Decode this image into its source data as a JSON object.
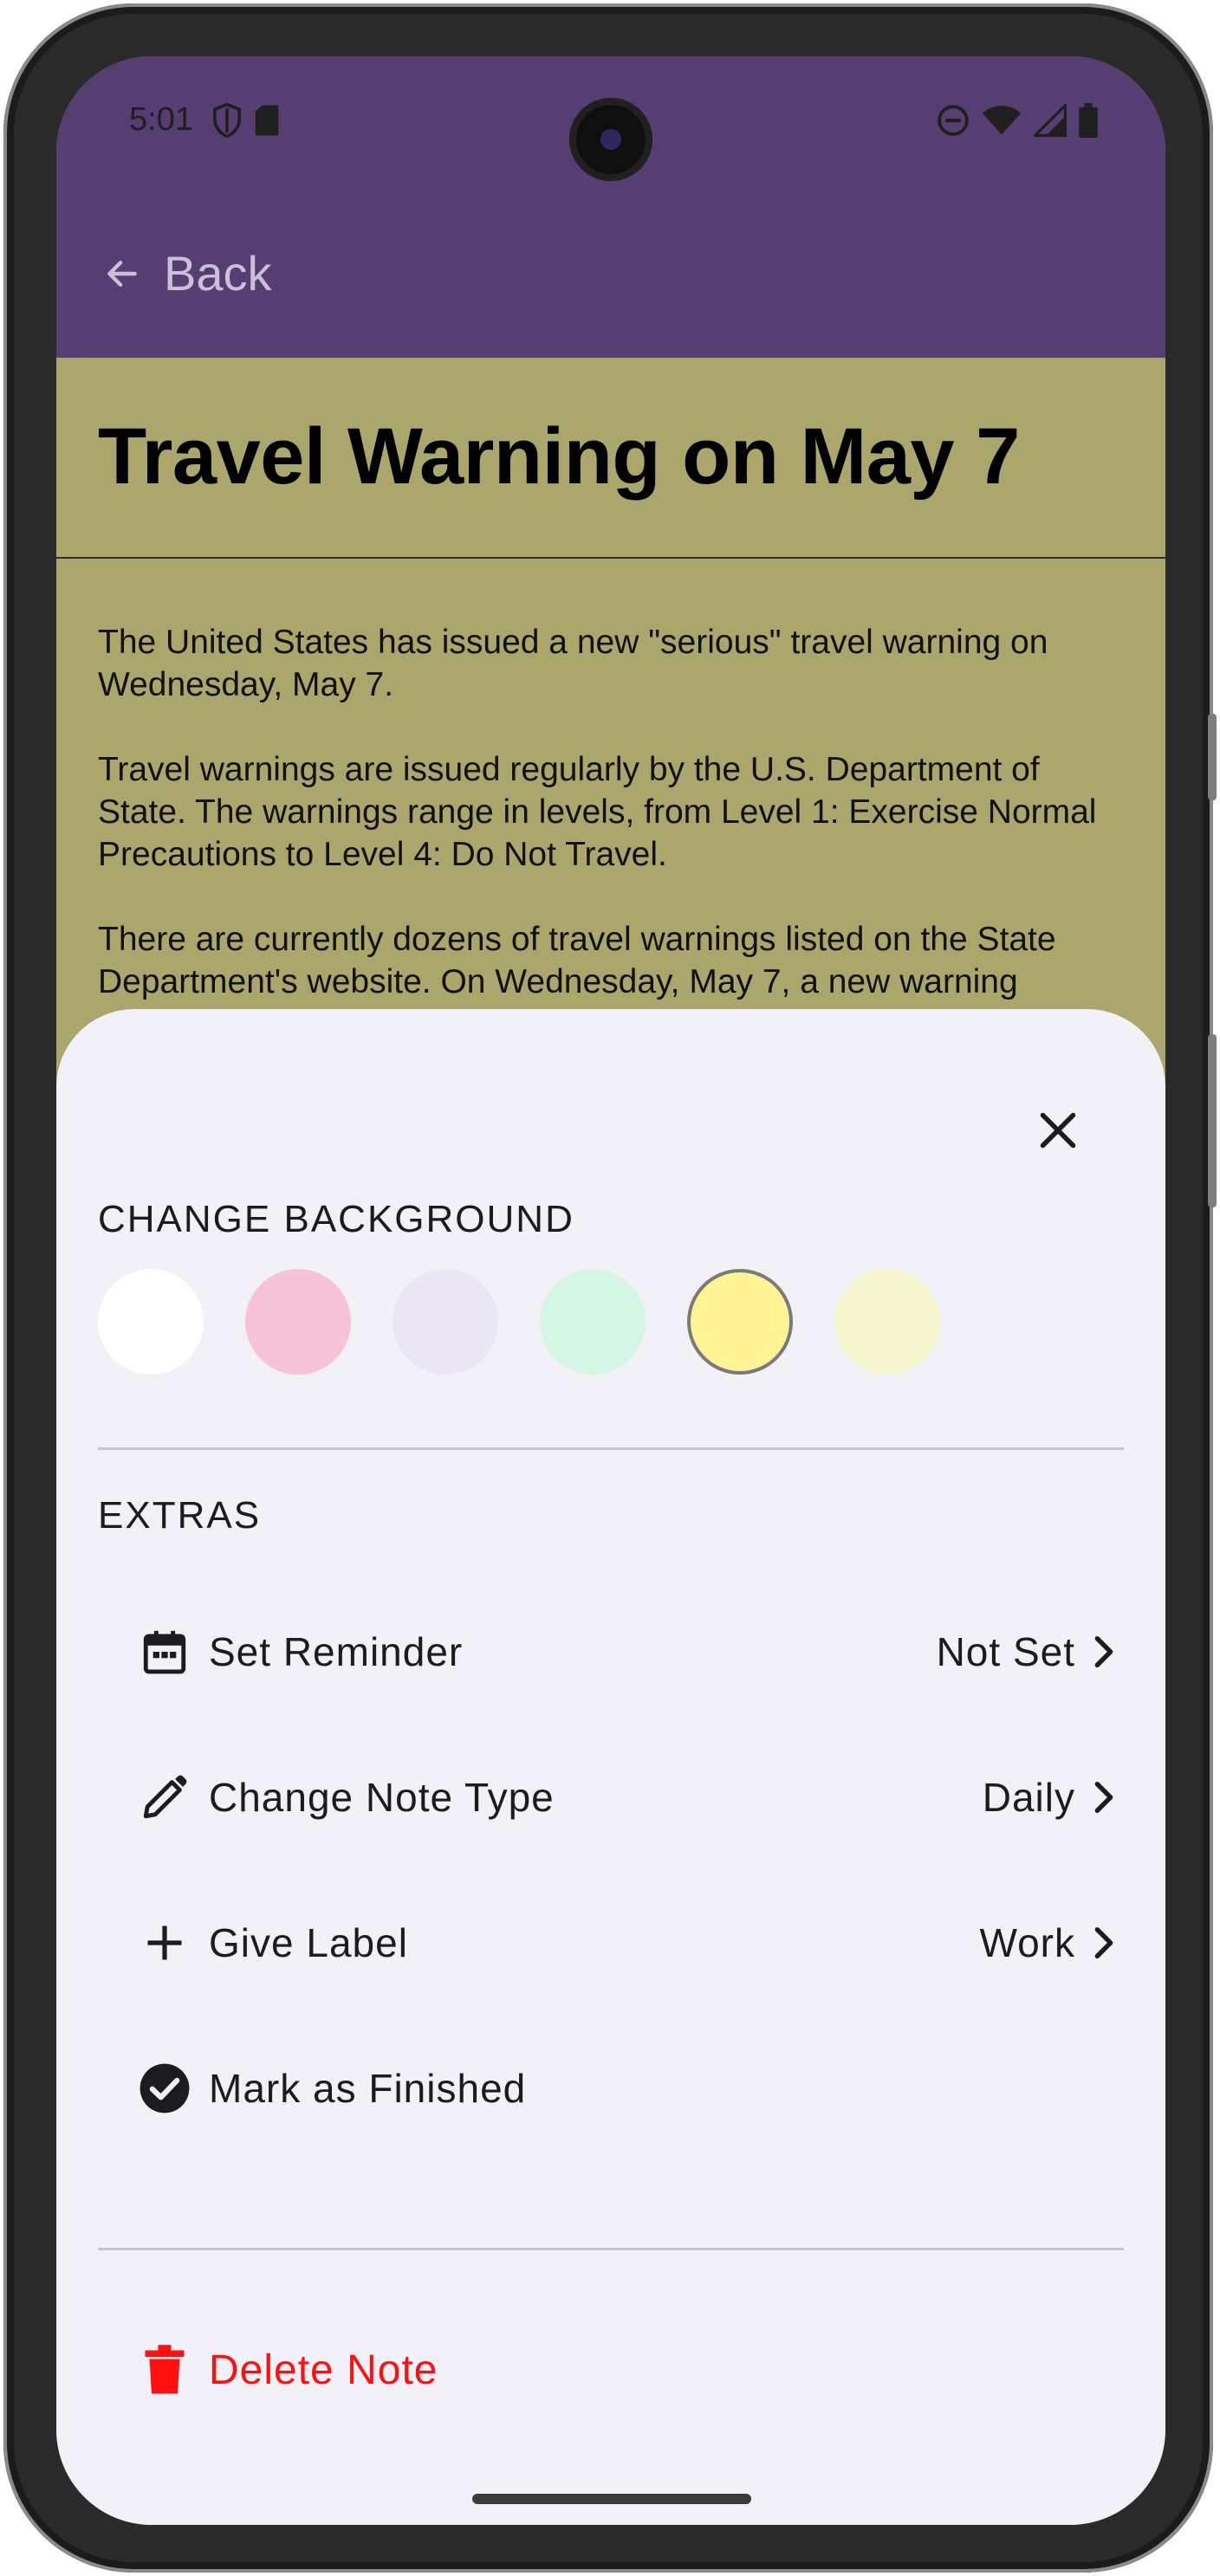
{
  "status_bar": {
    "time": "5:01",
    "left_icons": [
      "shield-icon",
      "sd-card-icon"
    ],
    "right_icons": [
      "do-not-disturb-icon",
      "wifi-icon",
      "signal-icon",
      "battery-icon"
    ]
  },
  "app_bar": {
    "back_label": "Back",
    "color": "#563e72"
  },
  "note": {
    "title": "Travel Warning on May 7",
    "background_color": "#aaa66c",
    "paragraphs": [
      "The United States has issued a new \"serious\" travel warning on Wednesday, May 7.",
      "Travel warnings are issued regularly by the U.S. Department of State. The warnings range in levels, from Level 1: Exercise Normal Precautions to Level 4: Do Not Travel.",
      "There are currently dozens of travel warnings listed on the State Department's website. On Wednesday, May 7, a new warning"
    ]
  },
  "sheet": {
    "change_background_label": "CHANGE BACKGROUND",
    "swatches": [
      {
        "name": "white",
        "color": "#ffffff",
        "selected": false
      },
      {
        "name": "pink",
        "color": "#f6c3d7",
        "selected": false
      },
      {
        "name": "lavender",
        "color": "#ebe6f4",
        "selected": false
      },
      {
        "name": "mint",
        "color": "#d4f6e4",
        "selected": false
      },
      {
        "name": "yellow",
        "color": "#fff494",
        "selected": true
      },
      {
        "name": "cream",
        "color": "#f5f5ce",
        "selected": false
      }
    ],
    "extras_label": "EXTRAS",
    "items": [
      {
        "icon": "calendar-icon",
        "label": "Set Reminder",
        "value": "Not Set"
      },
      {
        "icon": "pencil-icon",
        "label": "Change Note Type",
        "value": "Daily"
      },
      {
        "icon": "plus-icon",
        "label": "Give Label",
        "value": "Work"
      },
      {
        "icon": "check-circle-icon",
        "label": "Mark as Finished",
        "value": ""
      }
    ],
    "delete_label": "Delete Note",
    "delete_color": "#ff1010"
  }
}
